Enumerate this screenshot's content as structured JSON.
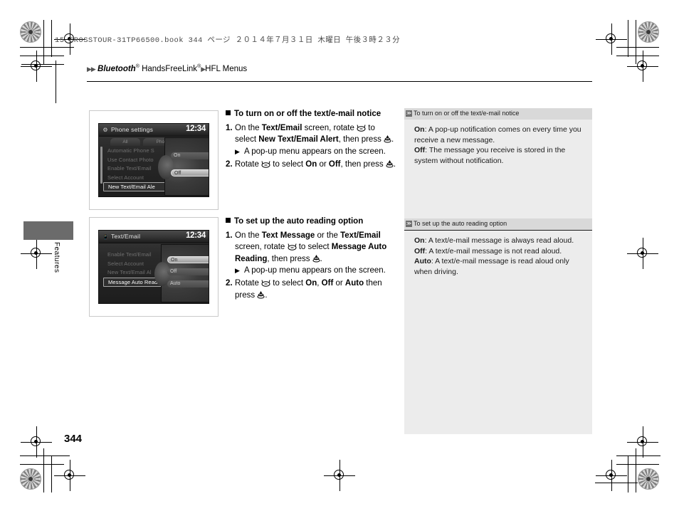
{
  "print": {
    "file_line": "15 CROSSTOUR-31TP66500.book   344 ページ   ２０１４年７月３１日   木曜日   午後３時２３分"
  },
  "breadcrumb": {
    "arrow1": "▶",
    "arrow2": "▶",
    "part1": "Bluetooth",
    "sup1": "®",
    "part2": " HandsFreeLink",
    "sup2": "®",
    "arrow3": "▶",
    "part3": "HFL Menus"
  },
  "side_tab": {
    "label": "Features"
  },
  "page_number": "344",
  "figures": [
    {
      "name": "phone-settings-screen",
      "title": "Phone settings",
      "title_icon": "gear-icon",
      "clock": "12:34",
      "tabs": [
        "All",
        "Phone"
      ],
      "menu": [
        {
          "label": "Automatic Phone S",
          "selected": false
        },
        {
          "label": "Use Contact Photo",
          "selected": false
        },
        {
          "label": "Enable Text/Email",
          "selected": false
        },
        {
          "label": "Select Account",
          "selected": false
        },
        {
          "label": "New Text/Email Ale",
          "selected": true
        }
      ],
      "popup": [
        {
          "label": "On",
          "highlighted": false
        },
        {
          "label": "Off",
          "highlighted": true
        }
      ]
    },
    {
      "name": "text-email-screen",
      "title": "Text/Email",
      "title_icon": "phone-message-icon",
      "clock": "12:34",
      "tabs": [],
      "menu": [
        {
          "label": "Enable Text/Email",
          "selected": false
        },
        {
          "label": "Select Account",
          "selected": false
        },
        {
          "label": "New Text/Email Al",
          "selected": false
        },
        {
          "label": "Message Auto Readi",
          "selected": true
        }
      ],
      "popup": [
        {
          "label": "On",
          "highlighted": true
        },
        {
          "label": "Off",
          "highlighted": false
        },
        {
          "label": "Auto",
          "highlighted": false
        }
      ]
    }
  ],
  "instructions": [
    {
      "heading": "To turn on or off the text/e-mail notice",
      "steps": [
        {
          "num": "1.",
          "segments": [
            {
              "t": "On the ",
              "b": false
            },
            {
              "t": "Text/Email",
              "b": true
            },
            {
              "t": " screen, rotate ",
              "b": false
            },
            {
              "t": "",
              "icon": "rotary-knob-icon"
            },
            {
              "t": " to select ",
              "b": false
            },
            {
              "t": "New Text/Email Alert",
              "b": true
            },
            {
              "t": ", then press ",
              "b": false
            },
            {
              "t": "",
              "icon": "enter-button-icon"
            },
            {
              "t": ".",
              "b": false
            }
          ]
        }
      ],
      "sub": "A pop-up menu appears on the screen.",
      "sub_arrow": "▶",
      "step2": {
        "num": "2.",
        "segments": [
          {
            "t": "Rotate ",
            "b": false
          },
          {
            "t": "",
            "icon": "rotary-knob-icon"
          },
          {
            "t": " to select ",
            "b": false
          },
          {
            "t": "On",
            "b": true
          },
          {
            "t": " or ",
            "b": false
          },
          {
            "t": "Off",
            "b": true
          },
          {
            "t": ", then press ",
            "b": false
          },
          {
            "t": "",
            "icon": "enter-button-icon"
          },
          {
            "t": ".",
            "b": false
          }
        ]
      }
    },
    {
      "heading": "To set up the auto reading option",
      "steps": [
        {
          "num": "1.",
          "segments": [
            {
              "t": "On the ",
              "b": false
            },
            {
              "t": "Text Message",
              "b": true
            },
            {
              "t": " or the ",
              "b": false
            },
            {
              "t": "Text/Email",
              "b": true
            },
            {
              "t": " screen, rotate ",
              "b": false
            },
            {
              "t": "",
              "icon": "rotary-knob-icon"
            },
            {
              "t": " to select ",
              "b": false
            },
            {
              "t": "Message Auto Reading",
              "b": true
            },
            {
              "t": ", then press ",
              "b": false
            },
            {
              "t": "",
              "icon": "enter-button-icon"
            },
            {
              "t": ".",
              "b": false
            }
          ]
        }
      ],
      "sub": "A pop-up menu appears on the screen.",
      "sub_arrow": "▶",
      "step2": {
        "num": "2.",
        "segments": [
          {
            "t": "Rotate ",
            "b": false
          },
          {
            "t": "",
            "icon": "rotary-knob-icon"
          },
          {
            "t": " to select ",
            "b": false
          },
          {
            "t": "On",
            "b": true
          },
          {
            "t": ", ",
            "b": false
          },
          {
            "t": "Off",
            "b": true
          },
          {
            "t": " or ",
            "b": false
          },
          {
            "t": "Auto",
            "b": true
          },
          {
            "t": " then press ",
            "b": false
          },
          {
            "t": "",
            "icon": "enter-button-icon"
          },
          {
            "t": ".",
            "b": false
          }
        ]
      }
    }
  ],
  "reference": [
    {
      "marker": "≫",
      "title": "To turn on or off the text/e-mail notice",
      "lines": [
        {
          "term": "On",
          "text": ": A pop-up notification comes on every time you receive a new message."
        },
        {
          "term": "Off",
          "text": ": The message you receive is stored in the system without notification."
        }
      ]
    },
    {
      "marker": "≫",
      "title": "To set up the auto reading option",
      "lines": [
        {
          "term": "On",
          "text": ": A text/e-mail message is always read aloud."
        },
        {
          "term": "Off",
          "text": ": A text/e-mail message is not read aloud."
        },
        {
          "term": "Auto",
          "text": ": A text/e-mail message is read aloud only when driving."
        }
      ]
    }
  ]
}
